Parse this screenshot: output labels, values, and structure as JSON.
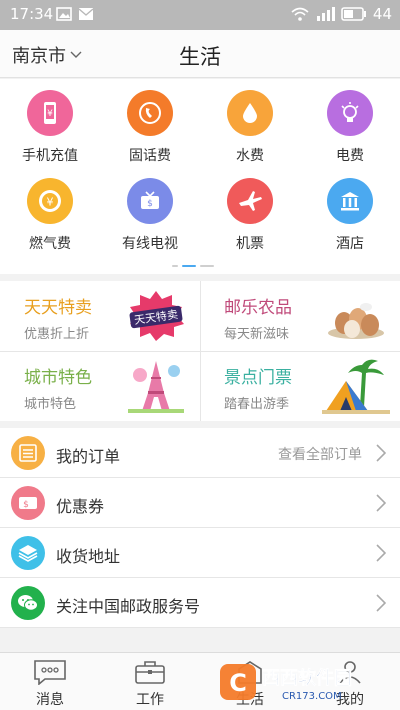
{
  "status_bar": {
    "time": "17:34",
    "battery": "44"
  },
  "header": {
    "city": "南京市",
    "title": "生活"
  },
  "services": [
    {
      "label": "手机充值",
      "icon": "phone-recharge-icon",
      "color": "#f0669a"
    },
    {
      "label": "固话费",
      "icon": "landline-icon",
      "color": "#f47b2a"
    },
    {
      "label": "水费",
      "icon": "water-drop-icon",
      "color": "#f8a43a"
    },
    {
      "label": "电费",
      "icon": "light-bulb-icon",
      "color": "#b86ee0"
    },
    {
      "label": "燃气费",
      "icon": "gas-coin-icon",
      "color": "#f8b52e"
    },
    {
      "label": "有线电视",
      "icon": "tv-icon",
      "color": "#7b8be8"
    },
    {
      "label": "机票",
      "icon": "airplane-icon",
      "color": "#f05a5a"
    },
    {
      "label": "酒店",
      "icon": "hotel-building-icon",
      "color": "#4ba9f0"
    }
  ],
  "promos": [
    {
      "title": "天天特卖",
      "subtitle": "优惠折上折",
      "title_color": "#e8a020",
      "badge": "天天特卖"
    },
    {
      "title": "邮乐农品",
      "subtitle": "每天新滋味",
      "title_color": "#c04a7a"
    },
    {
      "title": "城市特色",
      "subtitle": "城市特色",
      "title_color": "#7ab04a"
    },
    {
      "title": "景点门票",
      "subtitle": "踏春出游季",
      "title_color": "#3ab0a0"
    }
  ],
  "menu": [
    {
      "label": "我的订单",
      "right": "查看全部订单",
      "icon": "order-list-icon",
      "color": "#f7b044"
    },
    {
      "label": "优惠券",
      "right": "",
      "icon": "coupon-icon",
      "color": "#f07a8a"
    },
    {
      "label": "收货地址",
      "right": "",
      "icon": "address-layers-icon",
      "color": "#3fc0e8"
    },
    {
      "label": "关注中国邮政服务号",
      "right": "",
      "icon": "wechat-icon",
      "color": "#22b14c"
    }
  ],
  "tabs": [
    {
      "label": "消息",
      "icon": "message-icon"
    },
    {
      "label": "工作",
      "icon": "briefcase-icon"
    },
    {
      "label": "生活",
      "icon": "life-icon"
    },
    {
      "label": "我的",
      "icon": "profile-icon"
    }
  ],
  "watermark": {
    "text": "西西软件园",
    "url_text": "CR173.COM"
  }
}
